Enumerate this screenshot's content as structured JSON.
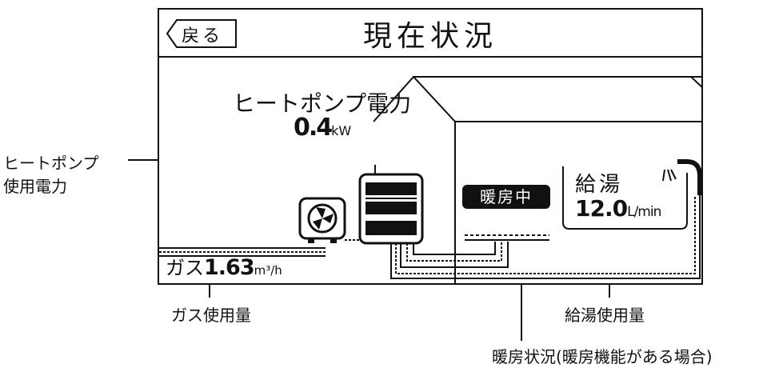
{
  "screen": {
    "back_label": "戻る",
    "title": "現在状況"
  },
  "heatpump": {
    "title": "ヒートポンプ電力",
    "value": "0.4",
    "unit": "kW"
  },
  "heating_status": "暖房中",
  "hot_water": {
    "label": "給湯",
    "value": "12.0",
    "unit": "L/min"
  },
  "gas": {
    "label": "ガス",
    "value": "1.63",
    "unit": "m³/h"
  },
  "callouts": {
    "heatpump_line1": "ヒートポンプ",
    "heatpump_line2": "使用電力",
    "gas_usage": "ガス使用量",
    "hot_water_usage": "給湯使用量",
    "heating_state": "暖房状況(暖房機能がある場合)"
  }
}
